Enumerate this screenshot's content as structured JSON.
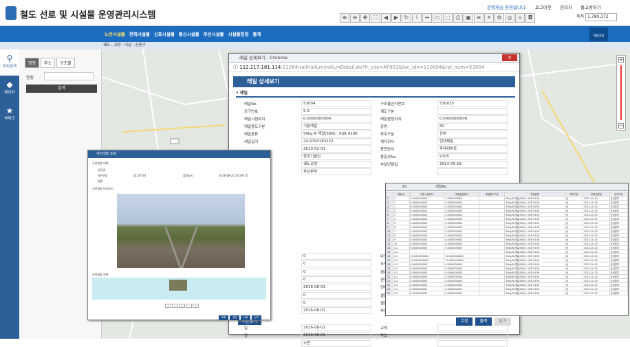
{
  "app": {
    "title": "철도 선로 및 시설물 운영관리시스템",
    "welcome": "문명재님 환영합니다.",
    "links": [
      "로그아웃",
      "관리자",
      "불고방하기"
    ],
    "scale_label": "축척",
    "scale_value": "1,780,372"
  },
  "nav": {
    "items": [
      "노반시설물",
      "전력시설물",
      "신호시설물",
      "통신시설물",
      "무선시설물",
      "시설물점검",
      "통계"
    ],
    "right_button": "레이어"
  },
  "breadcrumb": "궤도 : 교량 : 터널 : 공동구",
  "sidebar": {
    "items": [
      "위치검색",
      "레이어",
      "북마크"
    ]
  },
  "search_panel": {
    "tabs": [
      "명칭",
      "주소",
      "구조물"
    ],
    "field_label": "명칭",
    "button": "검색"
  },
  "popup": {
    "window_title": "레일 상세보기 - Chrome",
    "url_host": "112.217.181.114",
    "url_path": ":11264/rail/railLm/railLmDetail.do?fr_cde=AF001&fac_idn=110004&ral_num=53004",
    "header": "레일 상세보기",
    "section": "레일",
    "rows": [
      {
        "l": "레일No",
        "v": "53004",
        "l2": "구조물관리번호",
        "v2": "530015"
      },
      {
        "l": "공구번호",
        "v": "5-3",
        "l2": "궤도구분",
        "v2": ""
      },
      {
        "l": "레일시점위치",
        "v": "0.0000000000",
        "l2": "레일종점위치",
        "v2": "0.0000000000"
      },
      {
        "l": "레일용도구분",
        "v": "기본레일",
        "l2": "중량",
        "v2": "60"
      },
      {
        "l": "레일종류",
        "v": "50kg N 레일(50N) : KSR 9106",
        "l2": "좌우구분",
        "v2": "상부"
      },
      {
        "l": "레일길이",
        "v": "24.9700183222",
        "l2": "제작회사",
        "v2": "현대제철"
      },
      {
        "l": "",
        "v": "2013-02-01",
        "l2": "용접방식",
        "v2": "후레쉬버트"
      },
      {
        "l": "",
        "v": "중앙기술단",
        "l2": "용접공No",
        "v2": "9705"
      },
      {
        "l": "",
        "v": "궤도공영",
        "l2": "부설년월일",
        "v2": "2014-05-18"
      },
      {
        "l": "",
        "v": "호남본부",
        "l2": "",
        "v2": ""
      }
    ],
    "rows2": [
      {
        "l": "",
        "v": "0",
        "l2": "마모",
        "v2": ""
      },
      {
        "l": "",
        "v": "0",
        "l2": "부식",
        "v2": ""
      },
      {
        "l": "",
        "v": "0",
        "l2": "편마",
        "v2": ""
      },
      {
        "l": "",
        "v": "0",
        "l2": "편마",
        "v2": ""
      },
      {
        "l": "(회)",
        "v": "2016-08-01",
        "l2": "연마",
        "v2": ""
      },
      {
        "l": "(재)",
        "v": "0",
        "l2": "결함",
        "v2": ""
      },
      {
        "l": "(재)",
        "v": "0",
        "l2": "결함",
        "v2": ""
      },
      {
        "l": "리(회)",
        "v": "2016-08-01",
        "l2": "육안",
        "v2": ""
      }
    ],
    "rows3": [
      {
        "l": "일",
        "v": "2016-08-01",
        "l2": "교체",
        "v2": ""
      },
      {
        "l": "일",
        "v": "2016-08-01",
        "l2": "작업",
        "v2": ""
      },
      {
        "l": "",
        "v": "노반",
        "l2": "",
        "v2": ""
      }
    ],
    "buttons": [
      "수정",
      "출력",
      "닫기"
    ]
  },
  "photo_button": "사진보기",
  "photo_window": {
    "title": "사진대장 조회",
    "sec1": "사진대장 내역",
    "fields": [
      "사진명",
      "사진번호",
      "사진일시",
      "11:07:00",
      "촬영일시",
      "2016-08-21 10:49:15",
      "설명"
    ],
    "sec2": "사진대장 미리보기",
    "sec3": "사진대장 목록",
    "buttons": [
      "조회",
      "수정",
      "삭제",
      "닫기"
    ]
  },
  "excel": {
    "cell_ref": "A1",
    "formula": "레일No",
    "headers": [
      "레일No",
      "레일시점위치",
      "레일종점위치",
      "레일용도구분",
      "레일종류",
      "좌우구분",
      "부설년월일",
      "관리기관"
    ],
    "rows": [
      [
        "1",
        "0.0000000000",
        "0.0000000000",
        "",
        "50kg N 레일(50N) : KSR 9106",
        "상",
        "2013-10-15",
        "호남본부"
      ],
      [
        "1",
        "0.0000000000",
        "0.0000000000",
        "",
        "50kg N 레일(50N) : KSR 9106",
        "상",
        "2013-10-15",
        "호남본부"
      ],
      [
        "1",
        "0.0000000000",
        "0.0000000000",
        "",
        "50kg N 레일(50N) : KSR 9106",
        "상",
        "2013-10-15",
        "호남본부"
      ],
      [
        "2",
        "0.0000000000",
        "0.0000000000",
        "",
        "50kg N 레일(50N) : KSR 9106",
        "상",
        "2013-10-15",
        "호남본부"
      ],
      [
        "3",
        "0.0000000000",
        "0.0000000000",
        "",
        "50kg N 레일(50N) : KSR 9106",
        "상",
        "2013-10-15",
        "호남본부"
      ],
      [
        "4",
        "0.0000000000",
        "0.0000000000",
        "",
        "50kg N 레일(50N) : KSR 9106",
        "상",
        "2013-10-15",
        "호남본부"
      ],
      [
        "5",
        "0.0000000000",
        "0.0000000000",
        "",
        "50kg N 레일(50N) : KSR 9106",
        "상",
        "2013-10-15",
        "호남본부"
      ],
      [
        "6",
        "0.0000000000",
        "0.0000000000",
        "",
        "50kg N 레일(50N) : KSR 9106",
        "상",
        "2013-10-15",
        "호남본부"
      ],
      [
        "7",
        "0.0000000000",
        "0.0000000000",
        "",
        "50kg N 레일(50N) : KSR 9106",
        "상",
        "2013-10-15",
        "호남본부"
      ],
      [
        "8",
        "0.0000000000",
        "0.0000000000",
        "",
        "50kg N 레일(50N) : KSR 9106",
        "상",
        "2013-10-15",
        "호남본부"
      ],
      [
        "9",
        "0.0000000000",
        "0.0000000000",
        "",
        "50kg N 레일(50N) : KSR 9106",
        "상",
        "2013-10-15",
        "호남본부"
      ],
      [
        "10",
        "0.0000000000",
        "0.0000000000",
        "",
        "50kg N 레일(50N) : KSR 9106",
        "상",
        "2013-10-15",
        "호남본부"
      ],
      [
        "4-2",
        "0.0000000000",
        "0.0000000000",
        "",
        "50kg N 레일(50N) : KSR 9106",
        "상",
        "2013-10-24",
        "호남본부"
      ],
      [
        "4-2",
        "",
        "",
        "",
        "50kg N 레일(50N) : KSR 9106",
        "상",
        "2013-10-15",
        "호남본부"
      ],
      [
        "4-2",
        "10.2000000000",
        "10.2000000000",
        "",
        "50kg N 레일(50N) : KSR 9106",
        "상",
        "2013-10-15",
        "호남본부"
      ],
      [
        "4-2",
        "10.2000000000",
        "10.2000000000",
        "",
        "50kg N 레일(50N) : KSR 9106",
        "상",
        "2013-10-15",
        "호남본부"
      ],
      [
        "4-2",
        "0.0000000000",
        "0.0000000000",
        "",
        "50kg N 레일(50N) : KSR 9106",
        "상",
        "2013-10-15",
        "호남본부"
      ],
      [
        "4-2",
        "0.0000000000",
        "0.0000000000",
        "",
        "50kg N 레일(50N) : KSR 9106",
        "상",
        "2013-10-15",
        "호남본부"
      ],
      [
        "4-2",
        "0.0000000000",
        "0.0000000000",
        "",
        "50kg N 레일(50N) : KSR 9106",
        "상",
        "2013-10-15",
        "호남본부"
      ],
      [
        "4-2",
        "0.0000000000",
        "0.0000000000",
        "",
        "50kg N 레일(50N) : KSR 9106",
        "상",
        "2013-10-15",
        "호남본부"
      ],
      [
        "4-2",
        "0.0000000000",
        "0.0000000000",
        "",
        "50kg N 레일(50N) : KSR 9106",
        "상",
        "2013-10-15",
        "호남본부"
      ],
      [
        "4-2",
        "0.0000000000",
        "0.0000000000",
        "",
        "50kg N 레일(50N) : KSR 9106",
        "상",
        "2013-10-15",
        "호남본부"
      ],
      [
        "4-2",
        "0.0000000000",
        "0.0000000000",
        "",
        "50kg N 레일(50N) : KSR 9106",
        "상",
        "2013-10-15",
        "호남본부"
      ],
      [
        "4-2",
        "0.0000000000",
        "0.0000000000",
        "",
        "50kg N 레일(50N) : KSR 9106",
        "상",
        "2013-10-15",
        "호남본부"
      ]
    ]
  }
}
